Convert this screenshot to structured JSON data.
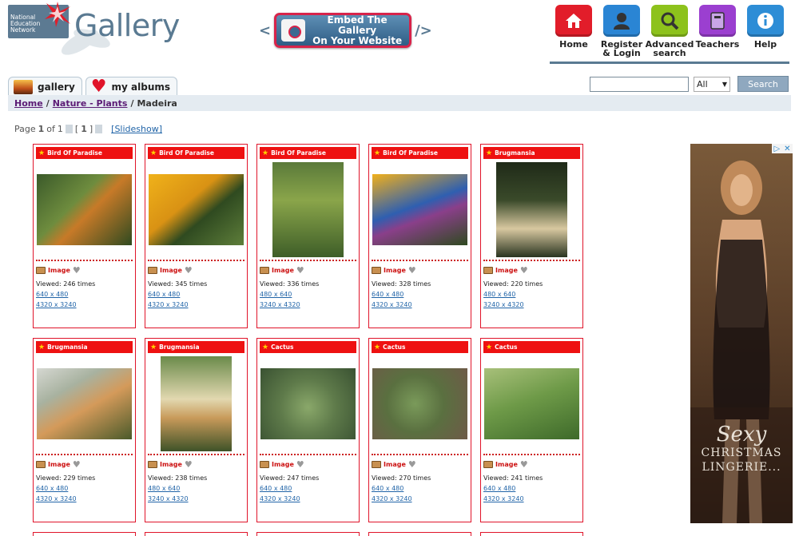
{
  "header": {
    "logo_text": "National Education Network",
    "site_title": "Gallery",
    "embed": {
      "line1": "Embed The Gallery",
      "line2": "On Your Website",
      "left_arrow": "<",
      "right_arrow": "/>"
    },
    "nav": [
      {
        "label": "Home",
        "icon": "house-icon",
        "color": "#e21d2a"
      },
      {
        "label": "Register & Login",
        "icon": "user-icon",
        "color": "#2a85d4"
      },
      {
        "label": "Advanced search",
        "icon": "magnifier-icon",
        "color": "#8dc21c"
      },
      {
        "label": "Teachers",
        "icon": "book-icon",
        "color": "#9b3fd0"
      },
      {
        "label": "Help",
        "icon": "info-icon",
        "color": "#2d8dd6"
      }
    ]
  },
  "tabs": [
    {
      "label": "gallery",
      "icon": "sunset-photo-icon"
    },
    {
      "label": "my albums",
      "icon": "heart-icon"
    }
  ],
  "search": {
    "value": "",
    "select": "All",
    "button": "Search"
  },
  "breadcrumb": {
    "home": "Home",
    "sep1": "/",
    "section": "Nature - Plants",
    "sep2": "/",
    "current": "Madeira"
  },
  "pager": {
    "text_page": "Page",
    "current": "1",
    "text_of": "of",
    "total": "1",
    "bracket_open": "[",
    "bracket_close": "]",
    "slideshow": "[Slideshow]"
  },
  "cards": [
    {
      "title": "Bird Of Paradise",
      "type": "Image",
      "viewed": "Viewed: 246 times",
      "size1": "640 x 480",
      "size2": "4320 x 3240"
    },
    {
      "title": "Bird Of Paradise",
      "type": "Image",
      "viewed": "Viewed: 345 times",
      "size1": "640 x 480",
      "size2": "4320 x 3240"
    },
    {
      "title": "Bird Of Paradise",
      "type": "Image",
      "viewed": "Viewed: 336 times",
      "size1": "480 x 640",
      "size2": "3240 x 4320"
    },
    {
      "title": "Bird Of Paradise",
      "type": "Image",
      "viewed": "Viewed: 328 times",
      "size1": "640 x 480",
      "size2": "4320 x 3240"
    },
    {
      "title": "Brugmansia",
      "type": "Image",
      "viewed": "Viewed: 220 times",
      "size1": "480 x 640",
      "size2": "3240 x 4320"
    },
    {
      "title": "Brugmansia",
      "type": "Image",
      "viewed": "Viewed: 229 times",
      "size1": "640 x 480",
      "size2": "4320 x 3240"
    },
    {
      "title": "Brugmansia",
      "type": "Image",
      "viewed": "Viewed: 238 times",
      "size1": "480 x 640",
      "size2": "3240 x 4320"
    },
    {
      "title": "Cactus",
      "type": "Image",
      "viewed": "Viewed: 247 times",
      "size1": "640 x 480",
      "size2": "4320 x 3240"
    },
    {
      "title": "Cactus",
      "type": "Image",
      "viewed": "Viewed: 270 times",
      "size1": "640 x 480",
      "size2": "4320 x 3240"
    },
    {
      "title": "Cactus",
      "type": "Image",
      "viewed": "Viewed: 241 times",
      "size1": "640 x 480",
      "size2": "4320 x 3240"
    }
  ],
  "ad": {
    "line1": "Sexy",
    "line2": "CHRISTMAS",
    "line3": "LINGERIE...",
    "close": "✕",
    "info": "▷"
  }
}
